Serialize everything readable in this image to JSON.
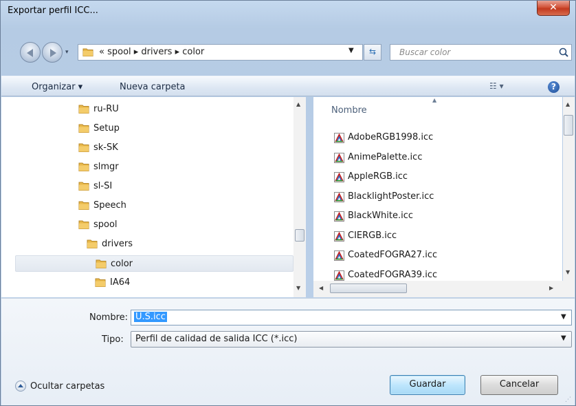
{
  "window": {
    "title": "Exportar perfil ICC..."
  },
  "address_bar": {
    "path": "« spool ▸ drivers ▸ color"
  },
  "search": {
    "placeholder": "Buscar color"
  },
  "toolbar": {
    "organize": "Organizar ▾",
    "new_folder": "Nueva carpeta"
  },
  "tree": {
    "items": [
      {
        "label": "ru-RU",
        "level": 0
      },
      {
        "label": "Setup",
        "level": 0
      },
      {
        "label": "sk-SK",
        "level": 0
      },
      {
        "label": "slmgr",
        "level": 0
      },
      {
        "label": "sl-SI",
        "level": 0
      },
      {
        "label": "Speech",
        "level": 0
      },
      {
        "label": "spool",
        "level": 0
      },
      {
        "label": "drivers",
        "level": 1
      },
      {
        "label": "color",
        "level": 2,
        "selected": true
      },
      {
        "label": "IA64",
        "level": 2
      }
    ]
  },
  "files": {
    "column_header": "Nombre",
    "items": [
      "AdobeRGB1998.icc",
      "AnimePalette.icc",
      "AppleRGB.icc",
      "BlacklightPoster.icc",
      "BlackWhite.icc",
      "CIERGB.icc",
      "CoatedFOGRA27.icc",
      "CoatedFOGRA39.icc"
    ]
  },
  "form": {
    "name_label": "Nombre:",
    "name_value": "U.S.icc",
    "type_label": "Tipo:",
    "type_value": "Perfil de calidad de salida ICC (*.icc)"
  },
  "footer": {
    "hide_folders": "Ocultar carpetas",
    "save": "Guardar",
    "cancel": "Cancelar"
  },
  "colors": {
    "folder": "#e8b84a",
    "selection": "#3399ff",
    "accent": "#2c6fb4"
  }
}
